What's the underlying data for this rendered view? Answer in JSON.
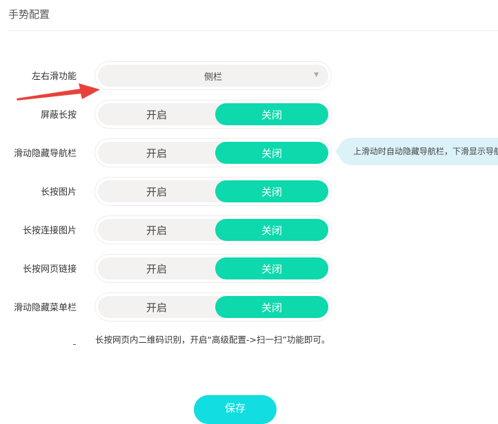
{
  "header": {
    "title": "手势配置"
  },
  "slide": {
    "label": "左右滑功能",
    "selected_value": "侧栏"
  },
  "toggles": [
    {
      "label": "屏蔽长按",
      "on_label": "开启",
      "off_label": "关闭",
      "state": "off"
    },
    {
      "label": "滑动隐藏导航栏",
      "on_label": "开启",
      "off_label": "关闭",
      "state": "off"
    },
    {
      "label": "长按图片",
      "on_label": "开启",
      "off_label": "关闭",
      "state": "off"
    },
    {
      "label": "长按连接图片",
      "on_label": "开启",
      "off_label": "关闭",
      "state": "off"
    },
    {
      "label": "长按网页链接",
      "on_label": "开启",
      "off_label": "关闭",
      "state": "off"
    },
    {
      "label": "滑动隐藏菜单栏",
      "on_label": "开启",
      "off_label": "关闭",
      "state": "off"
    }
  ],
  "tooltip": {
    "text": "上滑动时自动隐藏导航栏，下滑显示导航栏"
  },
  "note": {
    "text": "长按网页内二维码识别，开启“高级配置->扫一扫”功能即可。"
  },
  "actions": {
    "save_label": "保存"
  },
  "colors": {
    "accent": "#0dd9ad",
    "save_button": "#12dde0",
    "tooltip_bg": "#dcf2f9",
    "arrow": "#e8413a"
  },
  "icons": {
    "caret": "caret-down-icon",
    "annotation": "red-arrow-icon"
  }
}
